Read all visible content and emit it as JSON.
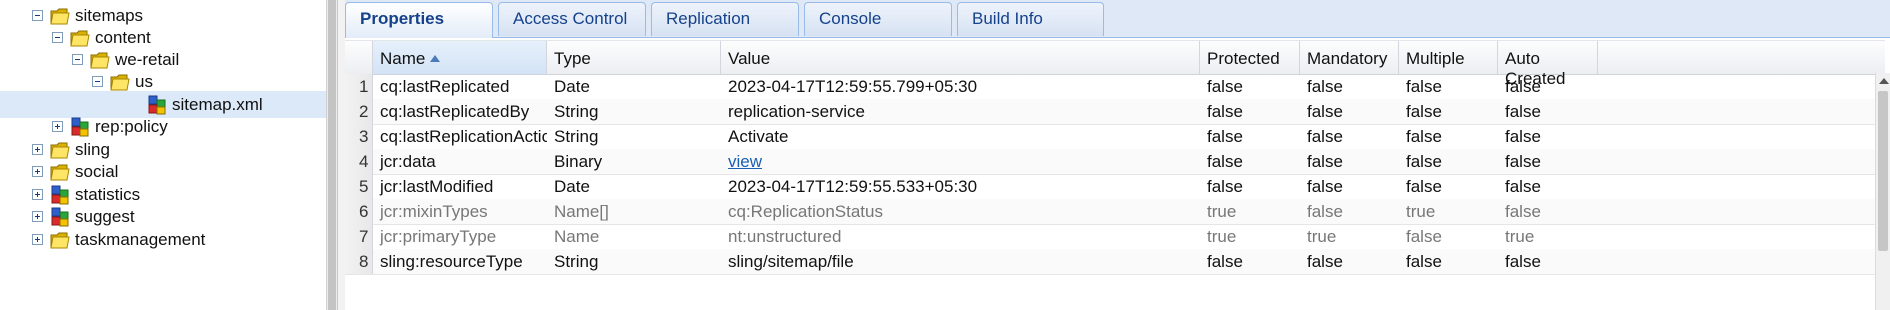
{
  "tree": {
    "nodes": [
      {
        "label": "sitemaps",
        "toggle": "minus",
        "icon": "folder",
        "selected": false
      },
      {
        "label": "content",
        "toggle": "minus",
        "icon": "folder",
        "selected": false
      },
      {
        "label": "we-retail",
        "toggle": "minus",
        "icon": "folder",
        "selected": false
      },
      {
        "label": "us",
        "toggle": "minus",
        "icon": "folder",
        "selected": false
      },
      {
        "label": "sitemap.xml",
        "toggle": "none",
        "icon": "node",
        "selected": true
      },
      {
        "label": "rep:policy",
        "toggle": "plus",
        "icon": "node",
        "selected": false
      },
      {
        "label": "sling",
        "toggle": "plus",
        "icon": "folder",
        "selected": false
      },
      {
        "label": "social",
        "toggle": "plus",
        "icon": "folder",
        "selected": false
      },
      {
        "label": "statistics",
        "toggle": "plus",
        "icon": "node",
        "selected": false
      },
      {
        "label": "suggest",
        "toggle": "plus",
        "icon": "node",
        "selected": false
      },
      {
        "label": "taskmanagement",
        "toggle": "plus",
        "icon": "folder",
        "selected": false
      }
    ]
  },
  "tabs": [
    {
      "label": "Properties",
      "active": true
    },
    {
      "label": "Access Control",
      "active": false
    },
    {
      "label": "Replication",
      "active": false
    },
    {
      "label": "Console",
      "active": false
    },
    {
      "label": "Build Info",
      "active": false
    }
  ],
  "grid": {
    "columns": [
      "Name",
      "Type",
      "Value",
      "Protected",
      "Mandatory",
      "Multiple",
      "Auto Created"
    ],
    "sorted_column": "Name",
    "sort_direction": "ascending",
    "rows": [
      {
        "num": "1",
        "name": "cq:lastReplicated",
        "type": "Date",
        "value": "2023-04-17T12:59:55.799+05:30",
        "protected": "false",
        "mandatory": "false",
        "multiple": "false",
        "auto": "false",
        "system": false,
        "link": false
      },
      {
        "num": "2",
        "name": "cq:lastReplicatedBy",
        "type": "String",
        "value": "replication-service",
        "protected": "false",
        "mandatory": "false",
        "multiple": "false",
        "auto": "false",
        "system": false,
        "link": false
      },
      {
        "num": "3",
        "name": "cq:lastReplicationAction",
        "type": "String",
        "value": "Activate",
        "protected": "false",
        "mandatory": "false",
        "multiple": "false",
        "auto": "false",
        "system": false,
        "link": false
      },
      {
        "num": "4",
        "name": "jcr:data",
        "type": "Binary",
        "value": "view",
        "protected": "false",
        "mandatory": "false",
        "multiple": "false",
        "auto": "false",
        "system": false,
        "link": true
      },
      {
        "num": "5",
        "name": "jcr:lastModified",
        "type": "Date",
        "value": "2023-04-17T12:59:55.533+05:30",
        "protected": "false",
        "mandatory": "false",
        "multiple": "false",
        "auto": "false",
        "system": false,
        "link": false
      },
      {
        "num": "6",
        "name": "jcr:mixinTypes",
        "type": "Name[]",
        "value": "cq:ReplicationStatus",
        "protected": "true",
        "mandatory": "false",
        "multiple": "true",
        "auto": "false",
        "system": true,
        "link": false
      },
      {
        "num": "7",
        "name": "jcr:primaryType",
        "type": "Name",
        "value": "nt:unstructured",
        "protected": "true",
        "mandatory": "true",
        "multiple": "false",
        "auto": "true",
        "system": true,
        "link": false
      },
      {
        "num": "8",
        "name": "sling:resourceType",
        "type": "String",
        "value": "sling/sitemap/file",
        "protected": "false",
        "mandatory": "false",
        "multiple": "false",
        "auto": "false",
        "system": false,
        "link": false
      }
    ]
  },
  "colors": {
    "selection": "#dce9f8",
    "tab_text": "#15428b",
    "link": "#1b5fb3",
    "system_text": "#777777"
  }
}
